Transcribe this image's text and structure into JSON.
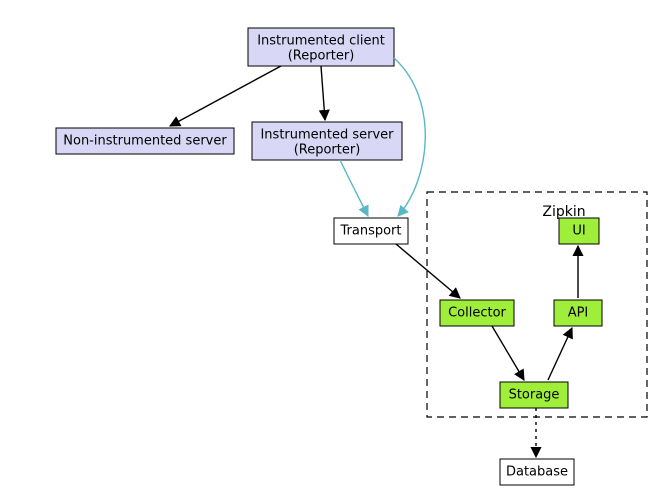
{
  "nodes": {
    "client": {
      "line1": "Instrumented client",
      "line2": "(Reporter)"
    },
    "noninstr": {
      "label": "Non-instrumented server"
    },
    "server": {
      "line1": "Instrumented server",
      "line2": "(Reporter)"
    },
    "transport": {
      "label": "Transport"
    },
    "collector": {
      "label": "Collector"
    },
    "storage": {
      "label": "Storage"
    },
    "api": {
      "label": "API"
    },
    "ui": {
      "label": "UI"
    },
    "database": {
      "label": "Database"
    }
  },
  "group": {
    "zipkin": "Zipkin"
  },
  "colors": {
    "lavender": "#d8d8f6",
    "green": "#9fee3a",
    "white": "#ffffff",
    "stroke": "#000000",
    "teal": "#58b8c4"
  }
}
